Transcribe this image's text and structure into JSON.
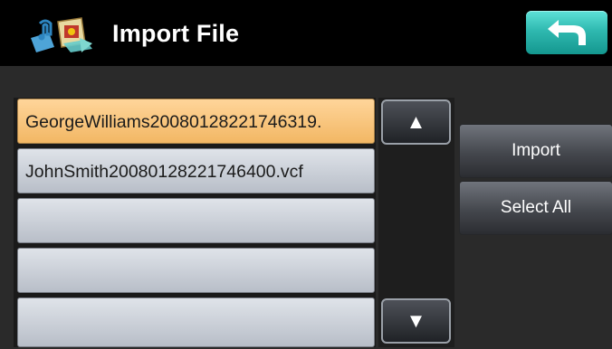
{
  "header": {
    "title": "Import File",
    "app_icon": "media-import-icon",
    "back_icon": "back-arrow-icon"
  },
  "file_list": {
    "items": [
      {
        "label": "GeorgeWilliams20080128221746319.",
        "selected": true
      },
      {
        "label": "JohnSmith20080128221746400.vcf",
        "selected": false
      },
      {
        "label": "",
        "selected": false
      },
      {
        "label": "",
        "selected": false
      },
      {
        "label": "",
        "selected": false
      }
    ]
  },
  "scroll": {
    "up_glyph": "▲",
    "down_glyph": "▼"
  },
  "actions": {
    "import_label": "Import",
    "select_all_label": "Select All"
  },
  "colors": {
    "selected_row": "#f2b764",
    "row": "#c7ccd3",
    "back_button": "#2fb9b0",
    "background": "#2a2a2a"
  }
}
